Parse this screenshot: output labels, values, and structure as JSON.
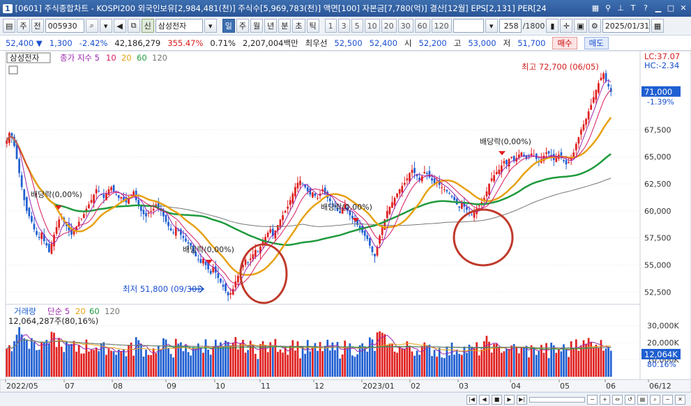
{
  "window": {
    "app_num": "1",
    "title": "[0601] 주식종합차트 - KOSPI200 외국인보유[2,984,481(천)] 주식수[5,969,783(천)] 액면[100] 자본금[7,780(억)] 결산[12월] EPS[2,131] PER[24"
  },
  "toolbar": {
    "market": "주",
    "prev": "전",
    "code": "005930",
    "name_tag": "신",
    "name": "삼성전자",
    "periods": [
      "일",
      "주",
      "월",
      "년",
      "분",
      "초",
      "틱"
    ],
    "active_period": "일",
    "intervals": [
      "1",
      "3",
      "5",
      "10",
      "20",
      "30",
      "60",
      "120"
    ],
    "count": "258",
    "count_max": "/1800",
    "date": "2025/01/31"
  },
  "quote": {
    "price": "52,400",
    "arrow": "▼",
    "change": "1,300",
    "change_pct": "-2.42%",
    "volume": "42,186,279",
    "vol_ratio": "355.47%",
    "turnover": "0.71%",
    "amount": "2,207,004백만",
    "pref_label": "최우선",
    "bid": "52,500",
    "ask": "52,400",
    "open_label": "시",
    "open": "52,200",
    "high_label": "고",
    "high": "53,000",
    "low_label": "저",
    "low": "51,700",
    "buy": "매수",
    "sell": "매도"
  },
  "chart_data": {
    "type": "line",
    "price_legend": {
      "name": "삼성전자",
      "ma_label": "종가 지수",
      "periods": [
        "5",
        "10",
        "20",
        "60",
        "120"
      ]
    },
    "volume_legend": {
      "name": "거래량",
      "ma_label": "단순",
      "periods": [
        "5",
        "20",
        "60",
        "120"
      ],
      "current": "12,064,287주(80,16%)"
    },
    "price_ticks": [
      "67,500",
      "65,000",
      "62,500",
      "60,000",
      "57,500",
      "55,000",
      "52,500"
    ],
    "price_ylim": [
      51500,
      73500
    ],
    "volume_ticks": [
      "30,000K",
      "20,000K",
      "10,000K"
    ],
    "volume_ylim": [
      0,
      36000
    ],
    "x_labels": [
      "2022/05",
      "07",
      "08",
      "09",
      "10",
      "11",
      "12",
      "2023/01",
      "02",
      "03",
      "04",
      "05",
      "06",
      "06/12"
    ],
    "right_labels": {
      "lc": "LC:37.07",
      "hc": "HC:-2.34",
      "last_price": "71,000",
      "last_pct": "-1.39%",
      "last_volume": "12,064K",
      "last_vol_pct": "80.16%"
    },
    "annotations": {
      "high": "최고 72,700 (06/05)",
      "low": "최저 51,800 (09/30)",
      "dividend": "배당락(0,00%)"
    },
    "close": [
      66500,
      67200,
      66800,
      66000,
      64800,
      63500,
      62200,
      61000,
      60000,
      59500,
      59000,
      58300,
      57800,
      57500,
      58000,
      57200,
      56800,
      56200,
      57000,
      57800,
      58500,
      59200,
      59500,
      59000,
      58600,
      58200,
      57800,
      58200,
      58500,
      59000,
      59300,
      59700,
      60200,
      60600,
      61000,
      61500,
      62000,
      61800,
      61500,
      61200,
      61600,
      62000,
      62200,
      61800,
      61500,
      61200,
      61300,
      61000,
      60800,
      61200,
      61500,
      61800,
      61000,
      60500,
      60000,
      59700,
      59500,
      59800,
      60000,
      60200,
      60600,
      60300,
      60000,
      59500,
      59000,
      58600,
      58200,
      58000,
      58500,
      58200,
      57800,
      57500,
      57200,
      57000,
      56800,
      56200,
      55800,
      55500,
      55200,
      55600,
      55000,
      54600,
      54200,
      54800,
      54300,
      53800,
      53400,
      53000,
      52600,
      52200,
      52400,
      52800,
      53500,
      54000,
      54600,
      55000,
      55500,
      55200,
      55600,
      56000,
      56400,
      56200,
      56700,
      57200,
      57600,
      58000,
      58300,
      57700,
      58200,
      58700,
      59200,
      59600,
      60000,
      60400,
      61000,
      61600,
      62200,
      62600,
      62800,
      62500,
      62200,
      61800,
      61500,
      61700,
      61400,
      61200,
      61600,
      62000,
      61600,
      61200,
      60900,
      60600,
      60400,
      60000,
      59800,
      60200,
      60600,
      60000,
      59600,
      59300,
      59000,
      58700,
      58400,
      58000,
      57700,
      57400,
      56800,
      56200,
      55800,
      56700,
      57700,
      58500,
      59200,
      60000,
      60400,
      60800,
      61200,
      61600,
      62000,
      62300,
      62600,
      63000,
      63500,
      63800,
      63500,
      63200,
      62800,
      63200,
      63600,
      63400,
      63100,
      62800,
      62500,
      62700,
      62400,
      62200,
      62000,
      61800,
      61600,
      61300,
      61000,
      60600,
      60300,
      60700,
      60400,
      60100,
      59800,
      59600,
      59900,
      60200,
      60500,
      60800,
      61200,
      61800,
      62500,
      63000,
      63300,
      63600,
      63800,
      64200,
      64600,
      64300,
      64800,
      65000,
      64600,
      64900,
      65200,
      65400,
      65100,
      64800,
      65000,
      65300,
      65100,
      64800,
      64500,
      64800,
      65100,
      65400,
      65300,
      65000,
      64700,
      64900,
      65200,
      64900,
      64600,
      64300,
      64500,
      64900,
      65400,
      66200,
      66800,
      67500,
      68000,
      68500,
      69200,
      69800,
      70500,
      71200,
      71800,
      72300,
      72700,
      72000,
      71500,
      71000
    ]
  }
}
